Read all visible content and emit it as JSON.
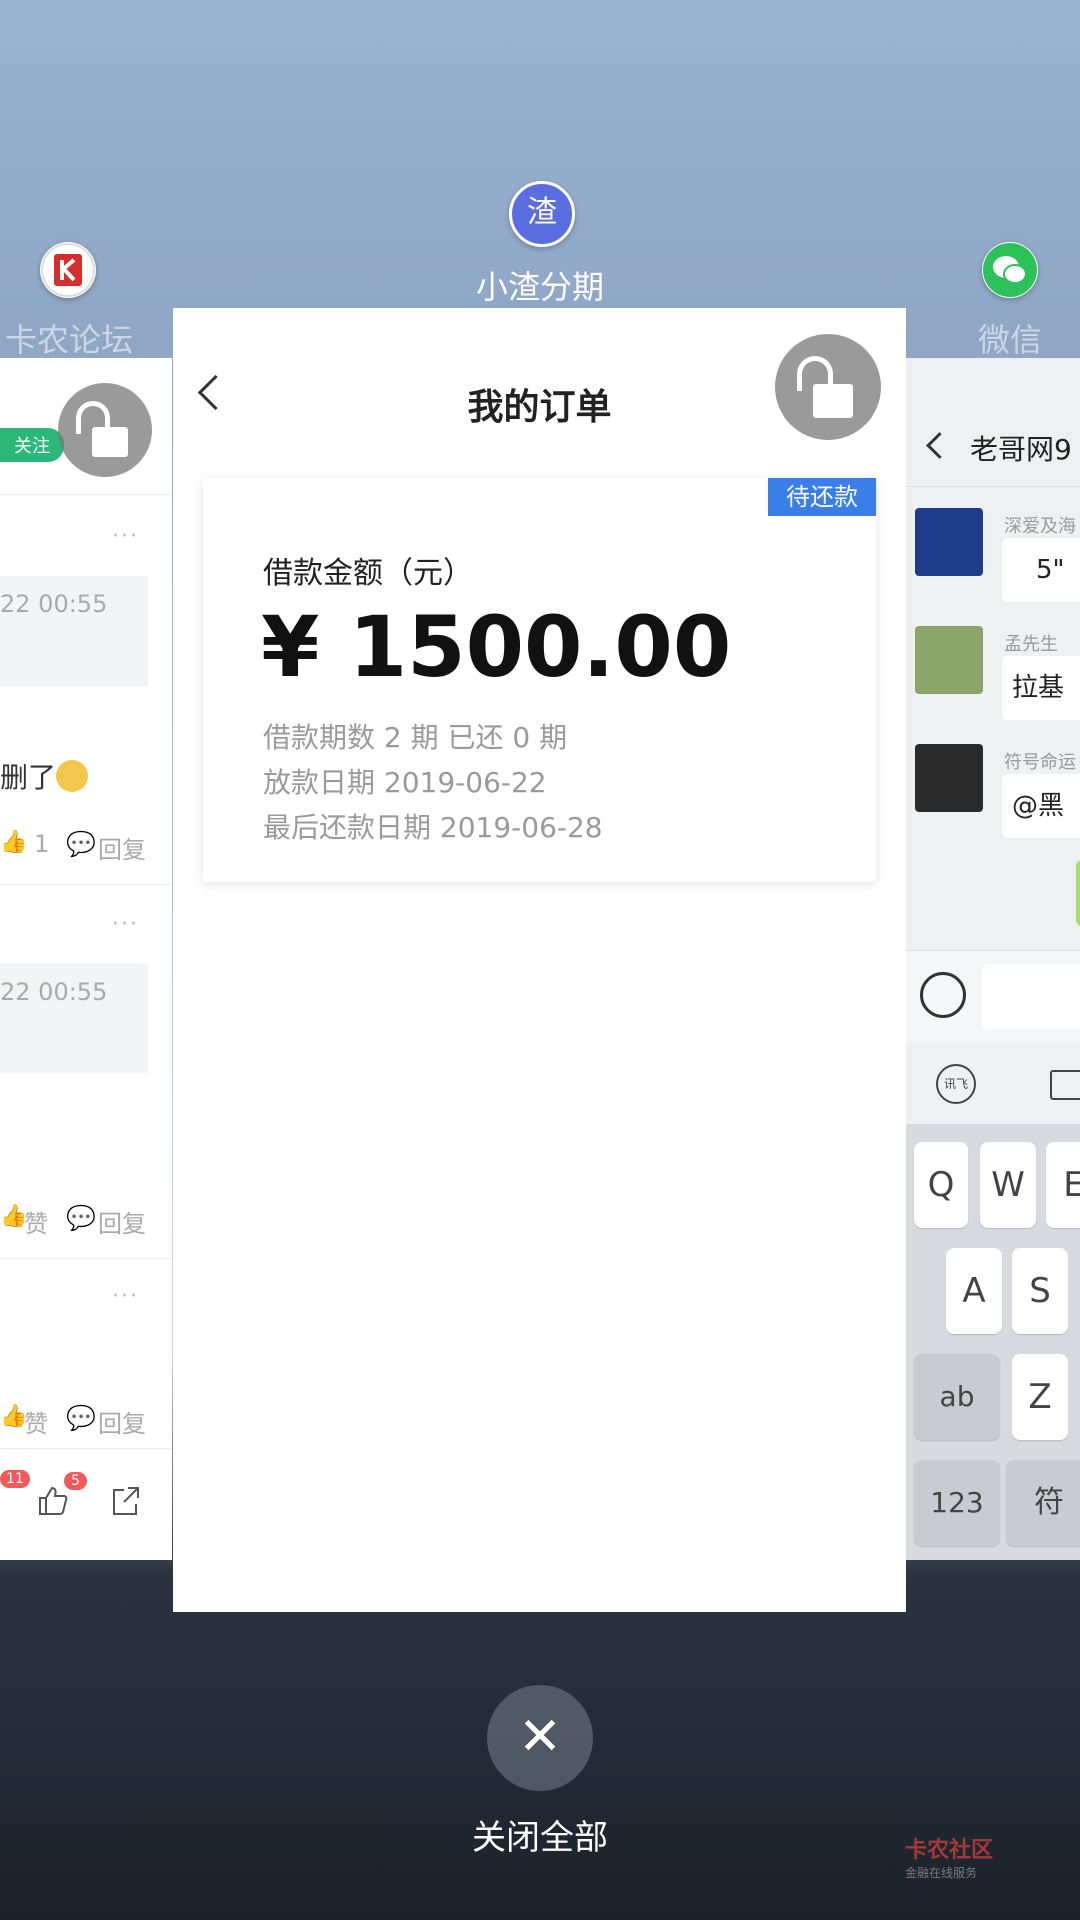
{
  "apps": {
    "left": {
      "title": "卡农论坛",
      "icon": "kanong-logo-icon"
    },
    "center": {
      "title": "小渣分期",
      "icon": "xiaozha-logo-icon",
      "icon_text": "渣"
    },
    "right": {
      "title": "微信",
      "icon": "wechat-logo-icon"
    }
  },
  "left_card": {
    "follow_label": "关注",
    "timestamp_1": "22 00:55",
    "post_text": "删了",
    "like_count": "1",
    "reply_label": "回复",
    "timestamp_2": "22 00:55",
    "like_label": "赞",
    "reply_label_2": "回复",
    "like_label_3": "赞",
    "reply_label_3": "回复",
    "badge_comments": "11",
    "badge_likes": "5"
  },
  "order_page": {
    "title": "我的订单",
    "status": "待还款",
    "amount_label": "借款金额（元）",
    "amount": "¥ 1500.00",
    "periods": "借款期数 2 期 已还 0 期",
    "loan_date": "放款日期 2019-06-22",
    "last_repay_date": "最后还款日期 2019-06-28"
  },
  "right_card": {
    "chat_title": "老哥网9",
    "messages": [
      {
        "name": "深爱及海",
        "text": "5\""
      },
      {
        "name": "孟先生",
        "text": "拉基"
      },
      {
        "name": "符号命运",
        "text": "@黑"
      }
    ],
    "keys_row1": [
      "Q",
      "W",
      "E"
    ],
    "keys_row2": [
      "A",
      "S"
    ],
    "key_ab": "ab",
    "key_z": "Z",
    "key_123": "123",
    "key_sym": "符",
    "xunfei_label": "讯飞"
  },
  "close_all_label": "关闭全部",
  "watermark": {
    "line1": "卡农社区",
    "line2": "金融在线服务"
  },
  "colors": {
    "status_tag": "#3a7ee8",
    "follow_badge": "#2bb67a",
    "badge_red": "#f05a5a"
  }
}
